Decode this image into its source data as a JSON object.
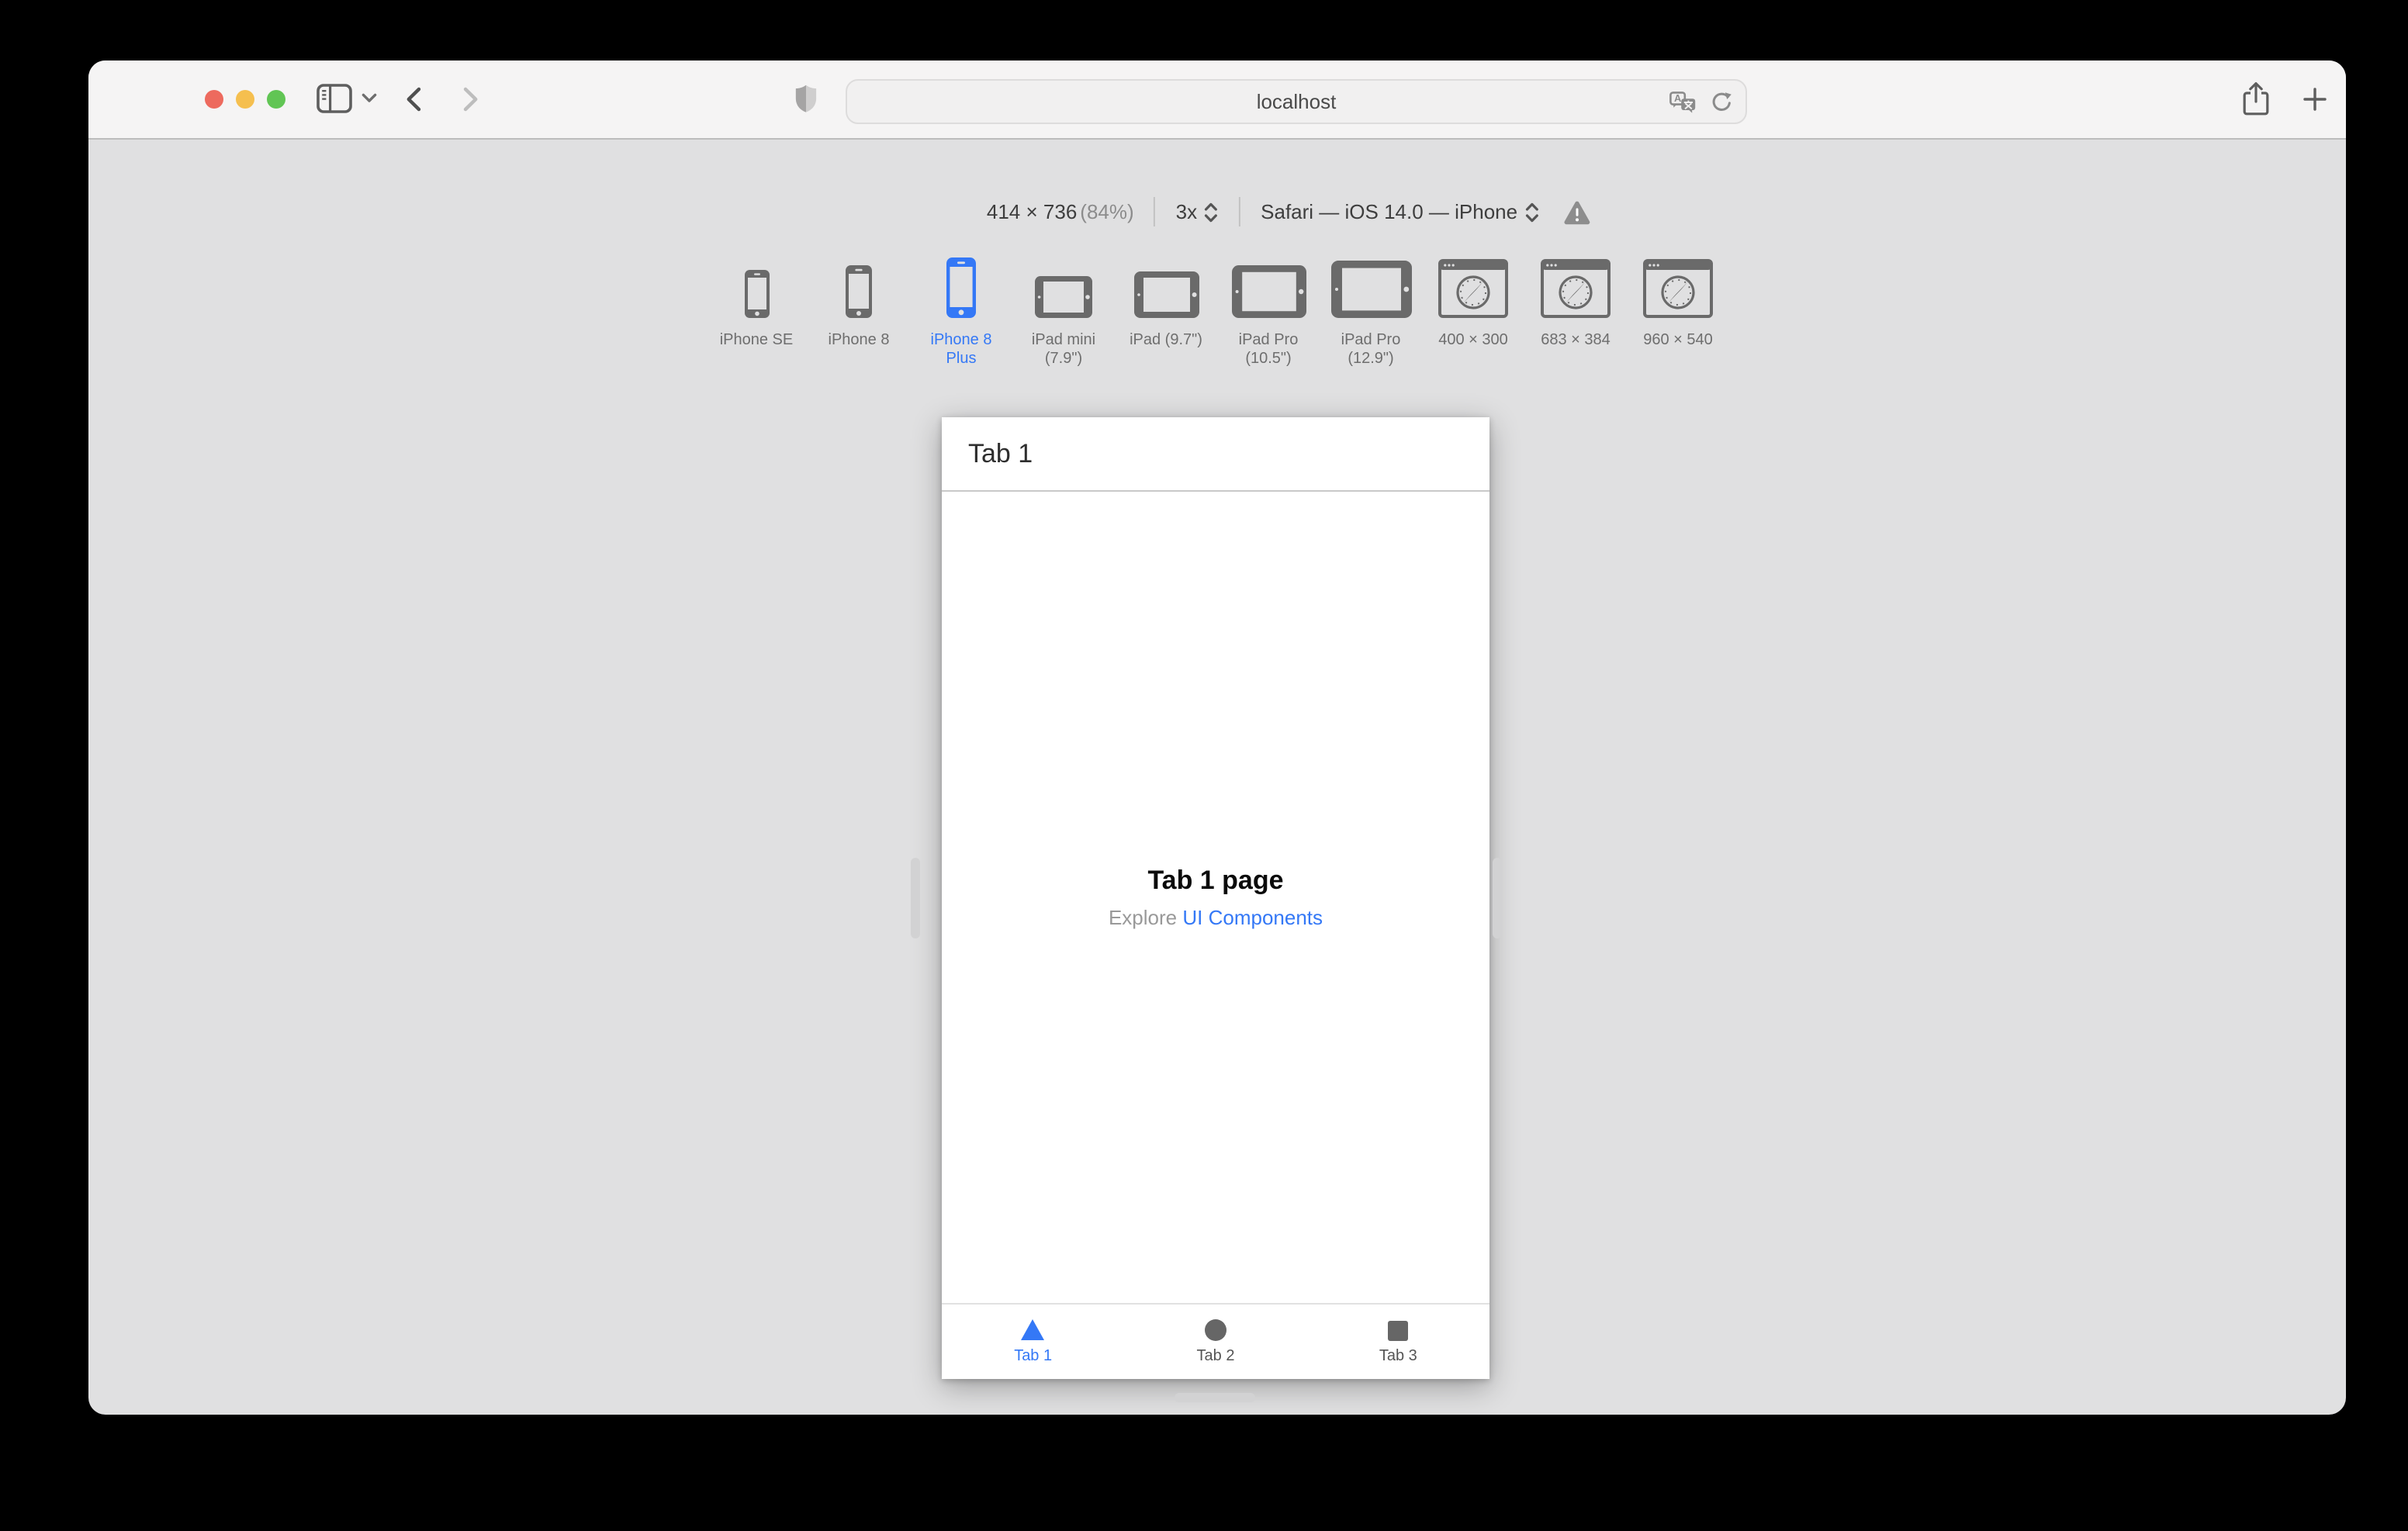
{
  "titlebar": {
    "url": "localhost"
  },
  "rdm": {
    "size": "414 × 736",
    "zoom": "(84%)",
    "pixel_ratio": "3x",
    "user_agent": "Safari — iOS 14.0 — iPhone"
  },
  "devices": [
    {
      "label": "iPhone SE",
      "type": "phone",
      "selected": false
    },
    {
      "label": "iPhone 8",
      "type": "phone",
      "selected": false
    },
    {
      "label": "iPhone 8 Plus",
      "type": "phone",
      "selected": true
    },
    {
      "label": "iPad mini (7.9\")",
      "type": "tablet",
      "selected": false
    },
    {
      "label": "iPad (9.7\")",
      "type": "tablet",
      "selected": false
    },
    {
      "label": "iPad Pro (10.5\")",
      "type": "tablet",
      "selected": false
    },
    {
      "label": "iPad Pro (12.9\")",
      "type": "tablet",
      "selected": false
    },
    {
      "label": "400 × 300",
      "type": "browser-window",
      "selected": false
    },
    {
      "label": "683 × 384",
      "type": "browser-window",
      "selected": false
    },
    {
      "label": "960 × 540",
      "type": "browser-window",
      "selected": false
    }
  ],
  "viewport": {
    "nav_title": "Tab 1",
    "page_title": "Tab 1 page",
    "explore_text": "Explore",
    "explore_link": "UI Components",
    "tabs": [
      {
        "label": "Tab 1",
        "icon": "triangle-icon",
        "active": true
      },
      {
        "label": "Tab 2",
        "icon": "circle-icon",
        "active": false
      },
      {
        "label": "Tab 3",
        "icon": "square-icon",
        "active": false
      }
    ]
  },
  "icons": {
    "toolbar": [
      "sidebar-toggle-icon",
      "chevron-down-icon",
      "back-icon",
      "forward-icon",
      "shield-icon",
      "translate-icon",
      "reload-icon",
      "share-icon",
      "new-tab-icon",
      "tab-overview-icon"
    ],
    "rdm": [
      "stepper-updown-icon",
      "warning-icon"
    ]
  },
  "colors": {
    "accent_blue": "#3478F6",
    "traffic_red": "#ED6A5E",
    "traffic_yellow": "#F5BF4F",
    "traffic_green": "#61C554",
    "toolbar_bg": "#F5F4F4",
    "content_bg": "#E0E0E1",
    "icon_gray": "#6A6A6A"
  }
}
